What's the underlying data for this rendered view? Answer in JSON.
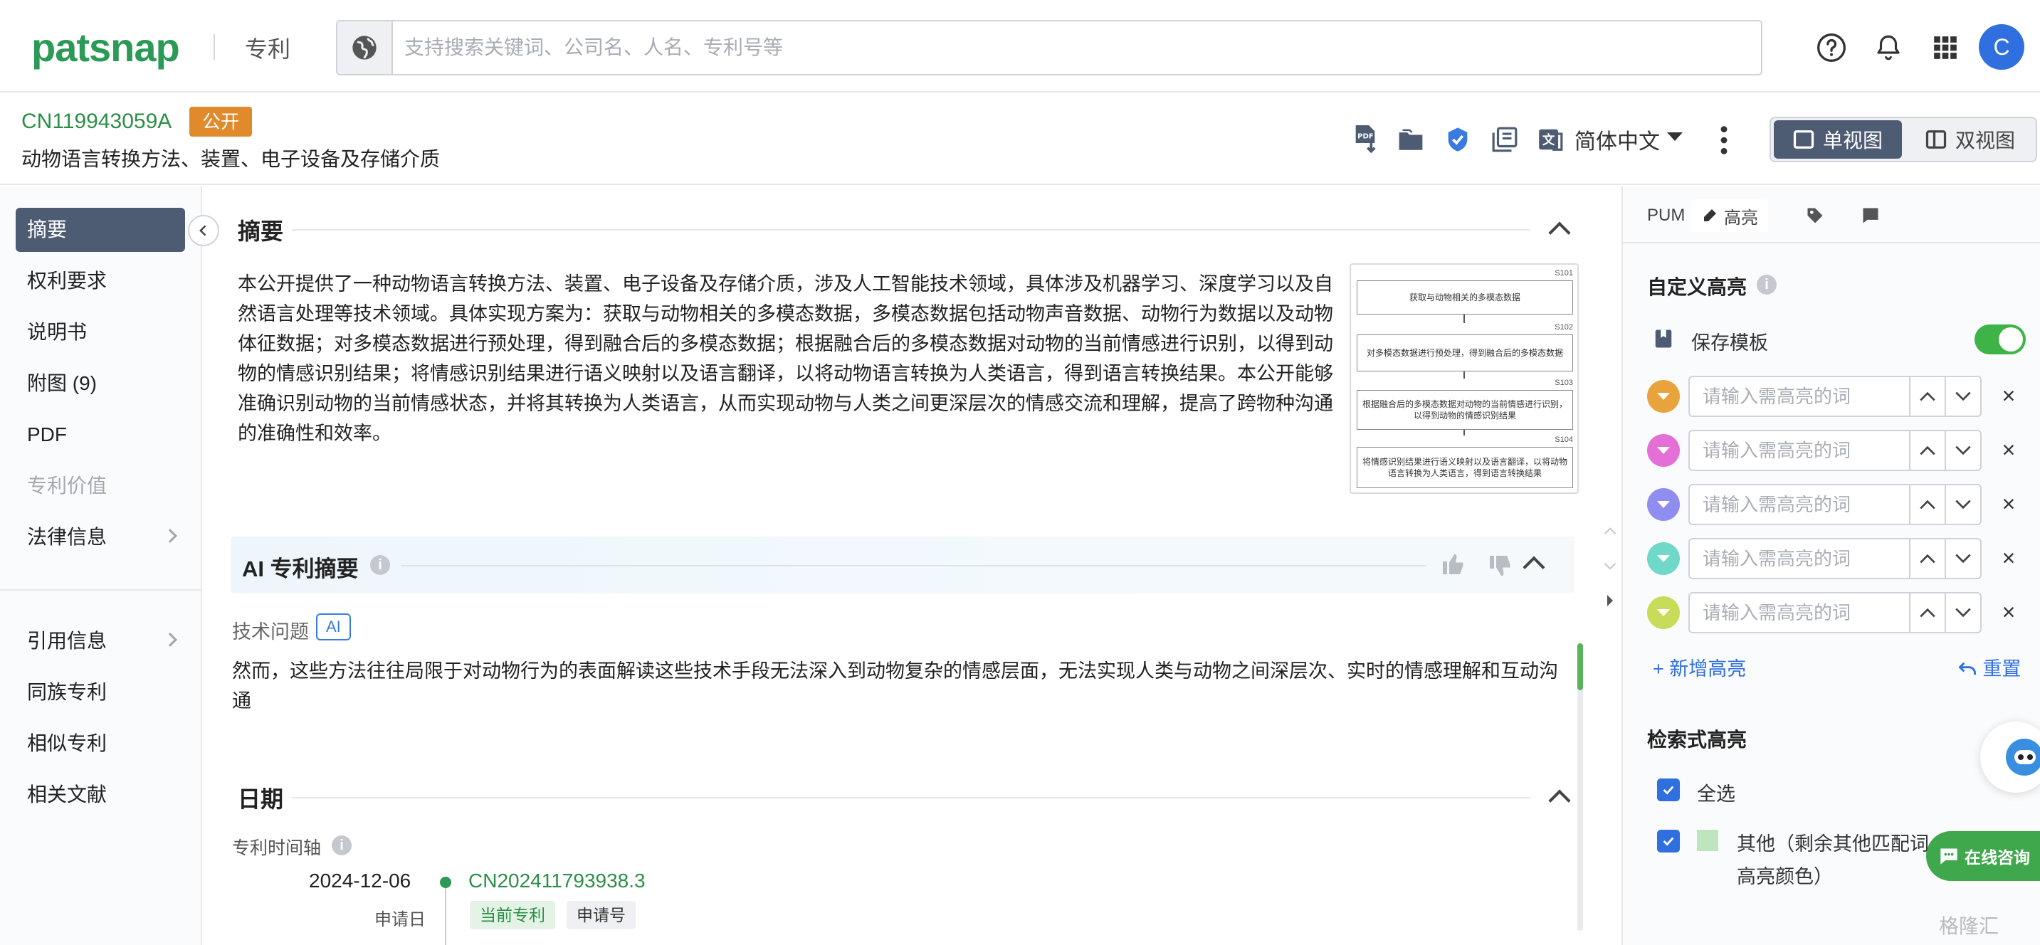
{
  "topnav": {
    "logo": "patsnap",
    "section_label": "专利",
    "search_placeholder": "支持搜索关键词、公司名、人名、专利号等",
    "avatar_letter": "C",
    "brand_color": "#2c9a57"
  },
  "patent": {
    "number": "CN119943059A",
    "status_badge": "公开",
    "title": "动物语言转换方法、装置、电子设备及存储介质",
    "language": "简体中文",
    "view_single": "单视图",
    "view_double": "双视图",
    "tool_pdf_label": "PDF"
  },
  "sidebar": {
    "items": [
      "摘要",
      "权利要求",
      "说明书",
      "附图 (9)",
      "PDF",
      "专利价值",
      "法律信息"
    ],
    "items2": [
      "引用信息",
      "同族专利",
      "相似专利",
      "相关文献"
    ]
  },
  "main": {
    "abstract_title": "摘要",
    "abstract_text": "本公开提供了一种动物语言转换方法、装置、电子设备及存储介质，涉及人工智能技术领域，具体涉及机器学习、深度学习以及自然语言处理等技术领域。具体实现方案为：获取与动物相关的多模态数据，多模态数据包括动物声音数据、动物行为数据以及动物体征数据；对多模态数据进行预处理，得到融合后的多模态数据；根据融合后的多模态数据对动物的当前情感进行识别，以得到动物的情感识别结果；将情感识别结果进行语义映射以及语言翻译，以将动物语言转换为人类语言，得到语言转换结果。本公开能够准确识别动物的当前情感状态，并将其转换为人类语言，从而实现动物与人类之间更深层次的情感交流和理解，提高了跨物种沟通的准确性和效率。",
    "flow": {
      "steps": [
        {
          "label": "S101",
          "text": "获取与动物相关的多模态数据"
        },
        {
          "label": "S102",
          "text": "对多模态数据进行预处理，得到融合后的多模态数据"
        },
        {
          "label": "S103",
          "text": "根据融合后的多模态数据对动物的当前情感进行识别，以得到动物的情感识别结果"
        },
        {
          "label": "S104",
          "text": "将情感识别结果进行语义映射以及语言翻译，以将动物语言转换为人类语言，得到语言转换结果"
        }
      ]
    },
    "ai_title": "AI 专利摘要",
    "tech_problem_label": "技术问题",
    "ai_tag": "AI",
    "tech_problem_text": "然而，这些方法往往局限于对动物行为的表面解读这些技术手段无法深入到动物复杂的情感层面，无法实现人类与动物之间深层次、实时的情感理解和互动沟通",
    "date_title": "日期",
    "timeline_label": "专利时间轴",
    "timeline": {
      "date": "2024-12-06",
      "app_number": "CN202411793938.3",
      "date_type": "申请日",
      "chip_current": "当前专利",
      "chip_appno": "申请号"
    }
  },
  "rpanel": {
    "tab_pum": "PUM",
    "tab_highlight": "高亮",
    "custom_highlight_title": "自定义高亮",
    "save_template": "保存模板",
    "highlight_placeholder": "请输入需高亮的词",
    "highlight_colors": [
      "#e8a33d",
      "#e46fd6",
      "#8f8ef0",
      "#6fd8c8",
      "#c9dc5a"
    ],
    "add_highlight": "+ 新增高亮",
    "reset": "重置",
    "search_highlight_title": "检索式高亮",
    "select_all": "全选",
    "other_label": "其他（剩余其他匹配词",
    "other_label2": "高亮颜色）",
    "chat_btn": "在线咨询",
    "watermark": "格隆汇"
  }
}
